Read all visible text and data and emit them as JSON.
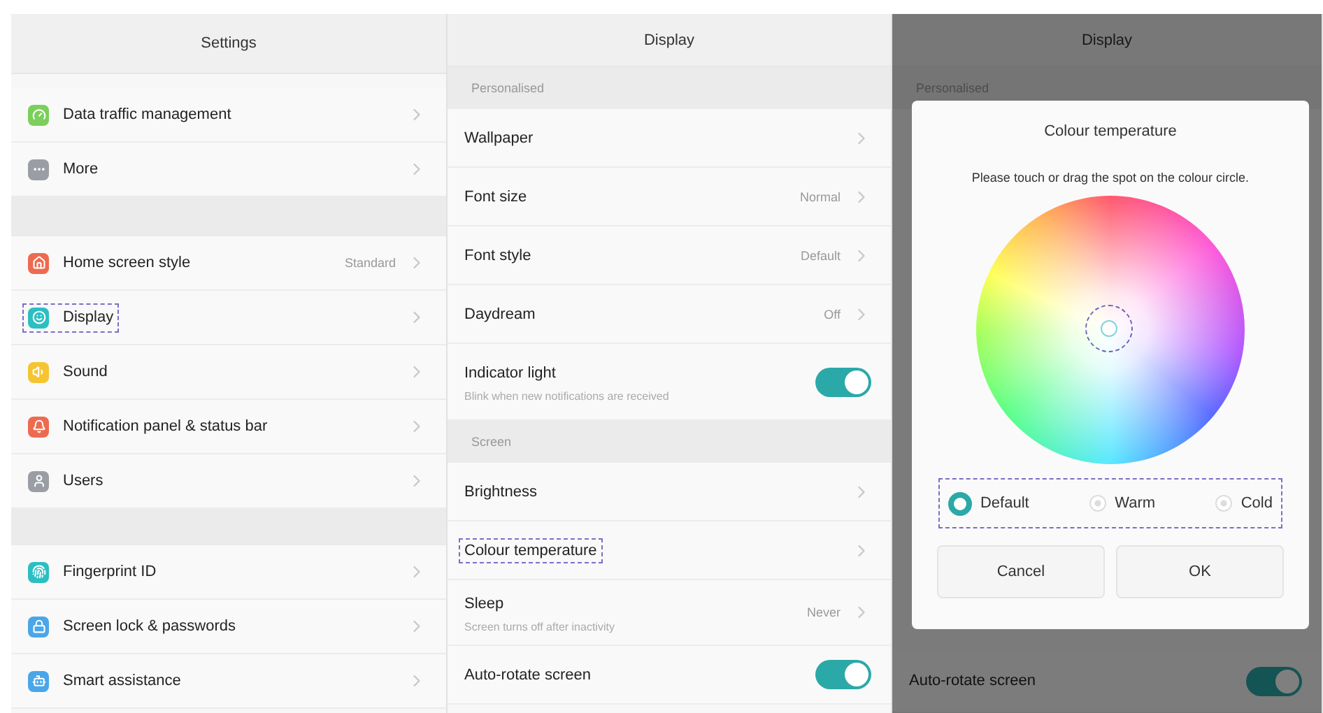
{
  "settings": {
    "title": "Settings",
    "groups": [
      {
        "items": [
          {
            "label": "Data traffic management",
            "color": "#7bcf5a",
            "highlighted": false
          },
          {
            "label": "More",
            "color": "#9a9ea4",
            "highlighted": false
          }
        ]
      },
      {
        "items": [
          {
            "label": "Home screen style",
            "value": "Standard",
            "color": "#ee6a4f",
            "highlighted": false
          },
          {
            "label": "Display",
            "color": "#2bbfc2",
            "highlighted": true
          },
          {
            "label": "Sound",
            "color": "#f5c531",
            "highlighted": false
          },
          {
            "label": "Notification panel & status bar",
            "color": "#ee6a4f",
            "highlighted": false
          },
          {
            "label": "Users",
            "color": "#9a9ea4",
            "highlighted": false
          }
        ]
      },
      {
        "items": [
          {
            "label": "Fingerprint ID",
            "color": "#2bbfc2",
            "highlighted": false
          },
          {
            "label": "Screen lock & passwords",
            "color": "#4aa6e8",
            "highlighted": false
          },
          {
            "label": "Smart assistance",
            "color": "#4aa6e8",
            "highlighted": false
          }
        ]
      }
    ]
  },
  "display": {
    "title": "Display",
    "sections": [
      {
        "label": "Personalised",
        "rows": [
          {
            "kind": "link",
            "label": "Wallpaper",
            "highlighted": false
          },
          {
            "kind": "link",
            "label": "Font size",
            "value": "Normal",
            "highlighted": false
          },
          {
            "kind": "link",
            "label": "Font style",
            "value": "Default",
            "highlighted": false
          },
          {
            "kind": "link",
            "label": "Daydream",
            "value": "Off",
            "highlighted": false
          },
          {
            "kind": "toggle",
            "label": "Indicator light",
            "subtitle": "Blink when new notifications are received",
            "on": true,
            "highlighted": false
          }
        ]
      },
      {
        "label": "Screen",
        "rows": [
          {
            "kind": "link",
            "label": "Brightness",
            "highlighted": false
          },
          {
            "kind": "link",
            "label": "Colour temperature",
            "highlighted": true
          },
          {
            "kind": "link",
            "label": "Sleep",
            "subtitle": "Screen turns off after inactivity",
            "value": "Never",
            "highlighted": false
          },
          {
            "kind": "toggle",
            "label": "Auto-rotate screen",
            "on": true,
            "highlighted": false
          }
        ]
      }
    ]
  },
  "dimmed_display": {
    "title": "Display",
    "section_label": "Personalised",
    "rows": [
      {
        "label": "Auto-rotate screen",
        "on": true
      }
    ]
  },
  "dialog": {
    "title": "Colour temperature",
    "instruction": "Please touch or drag the spot on the colour circle.",
    "options": [
      {
        "label": "Default",
        "selected": true
      },
      {
        "label": "Warm",
        "selected": false
      },
      {
        "label": "Cold",
        "selected": false
      }
    ],
    "buttons": [
      "Cancel",
      "OK"
    ]
  }
}
